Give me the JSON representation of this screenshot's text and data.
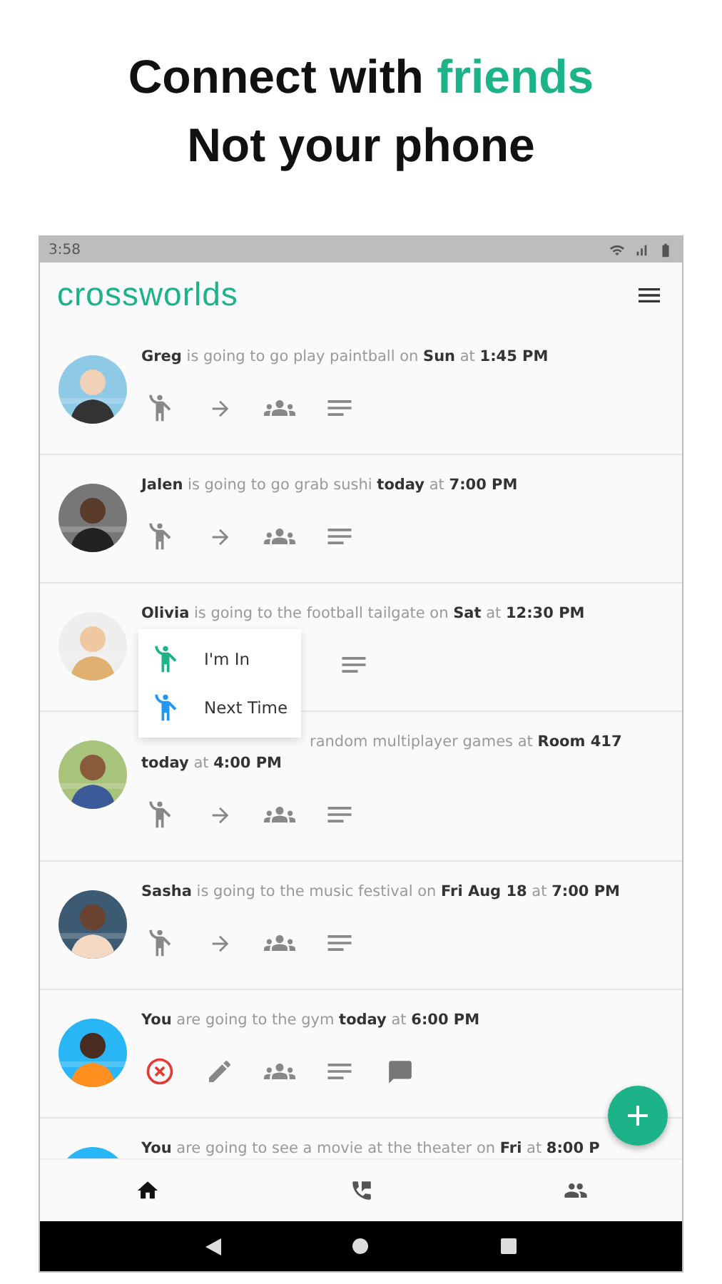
{
  "headline": {
    "lines": [
      "Connect with **friends**",
      "Not your phone"
    ]
  },
  "status_bar": {
    "time": "3:58"
  },
  "app_bar": {
    "logo": "crossworlds"
  },
  "feed": [
    {
      "text": "**Greg** is going to go play paintball on **Sun** at **1:45 PM**",
      "actions": [
        {
          "kind": "join"
        },
        {
          "kind": "forward"
        },
        {
          "kind": "group"
        },
        {
          "kind": "notes"
        }
      ]
    },
    {
      "text": "**Jalen** is going to go grab sushi **today** at **7:00 PM**",
      "actions": [
        {
          "kind": "join"
        },
        {
          "kind": "forward"
        },
        {
          "kind": "group"
        },
        {
          "kind": "notes"
        }
      ]
    },
    {
      "text": "**Olivia** is going to the football tailgate on **Sat** at **12:30 PM**",
      "actions": [
        {
          "kind": "notes"
        }
      ],
      "menu": [
        {
          "label": "I'm In",
          "color": "#1db388"
        },
        {
          "label": "Next Time",
          "color": "#2196f3"
        }
      ]
    },
    {
      "text": "random multiplayer games at **Room 417** **today** at **4:00 PM**",
      "covered": true,
      "actions": [
        {
          "kind": "join"
        },
        {
          "kind": "forward"
        },
        {
          "kind": "group"
        },
        {
          "kind": "notes"
        }
      ]
    },
    {
      "text": "**Sasha** is going to the music festival on **Fri Aug 18** at **7:00 PM**",
      "actions": [
        {
          "kind": "join"
        },
        {
          "kind": "forward"
        },
        {
          "kind": "group"
        },
        {
          "kind": "notes"
        }
      ]
    },
    {
      "text": "**You** are going to the gym **today** at **6:00 PM**",
      "actions": [
        {
          "kind": "cancel"
        },
        {
          "kind": "edit"
        },
        {
          "kind": "group"
        },
        {
          "kind": "notes"
        },
        {
          "kind": "comment"
        }
      ]
    },
    {
      "text": "**You** are going to see a movie at the theater on **Fri** at **8:00 P**"
    }
  ],
  "bottom_nav": [
    {
      "kind": "home",
      "selected": true
    },
    {
      "kind": "calls",
      "selected": false
    },
    {
      "kind": "friends",
      "selected": false
    }
  ]
}
